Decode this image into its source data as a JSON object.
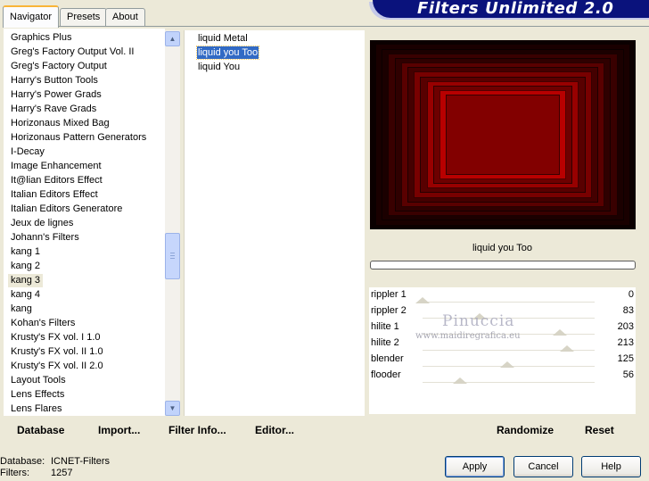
{
  "tabs": [
    "Navigator",
    "Presets",
    "About"
  ],
  "banner_title": "Filters Unlimited 2.0",
  "categories": [
    "Graphics Plus",
    "Greg's Factory Output Vol. II",
    "Greg's Factory Output",
    "Harry's Button Tools",
    "Harry's Power Grads",
    "Harry's Rave Grads",
    "Horizonaus Mixed Bag",
    "Horizonaus Pattern Generators",
    "I-Decay",
    "Image Enhancement",
    "It@lian Editors Effect",
    "Italian Editors Effect",
    "Italian Editors Generatore",
    "Jeux de lignes",
    "Johann's Filters",
    "kang 1",
    "kang 2",
    "kang 3",
    "kang 4",
    "kang",
    "Kohan's Filters",
    "Krusty's FX vol. I 1.0",
    "Krusty's FX vol. II 1.0",
    "Krusty's FX vol. II 2.0",
    "Layout Tools",
    "Lens Effects",
    "Lens Flares"
  ],
  "selected_category": "kang 3",
  "filters": [
    "liquid Metal",
    "liquid you Too",
    "liquid You"
  ],
  "selected_filter": "liquid you Too",
  "current_filter_name": "liquid you Too",
  "params": [
    {
      "name": "rippler 1",
      "value": "0",
      "level": 0
    },
    {
      "name": "rippler 2",
      "value": "83",
      "level": 0.33
    },
    {
      "name": "hilite 1",
      "value": "203",
      "level": 0.8
    },
    {
      "name": "hilite 2",
      "value": "213",
      "level": 0.84
    },
    {
      "name": "blender",
      "value": "125",
      "level": 0.49
    },
    {
      "name": "flooder",
      "value": "56",
      "level": 0.22
    }
  ],
  "watermark": {
    "name": "Pinuccia",
    "url": "www.maidiregrafica.eu"
  },
  "links": {
    "database": "Database",
    "import": "Import...",
    "filter_info": "Filter Info...",
    "editor": "Editor...",
    "randomize": "Randomize",
    "reset": "Reset"
  },
  "info": {
    "database_label": "Database:",
    "database_value": "ICNET-Filters",
    "filters_label": "Filters:",
    "filters_value": "1257"
  },
  "buttons": {
    "apply": "Apply",
    "cancel": "Cancel",
    "help": "Help"
  },
  "colors": {
    "banner": "#0a127c",
    "selection": "#316ac5",
    "preview_red": "#c00000"
  }
}
